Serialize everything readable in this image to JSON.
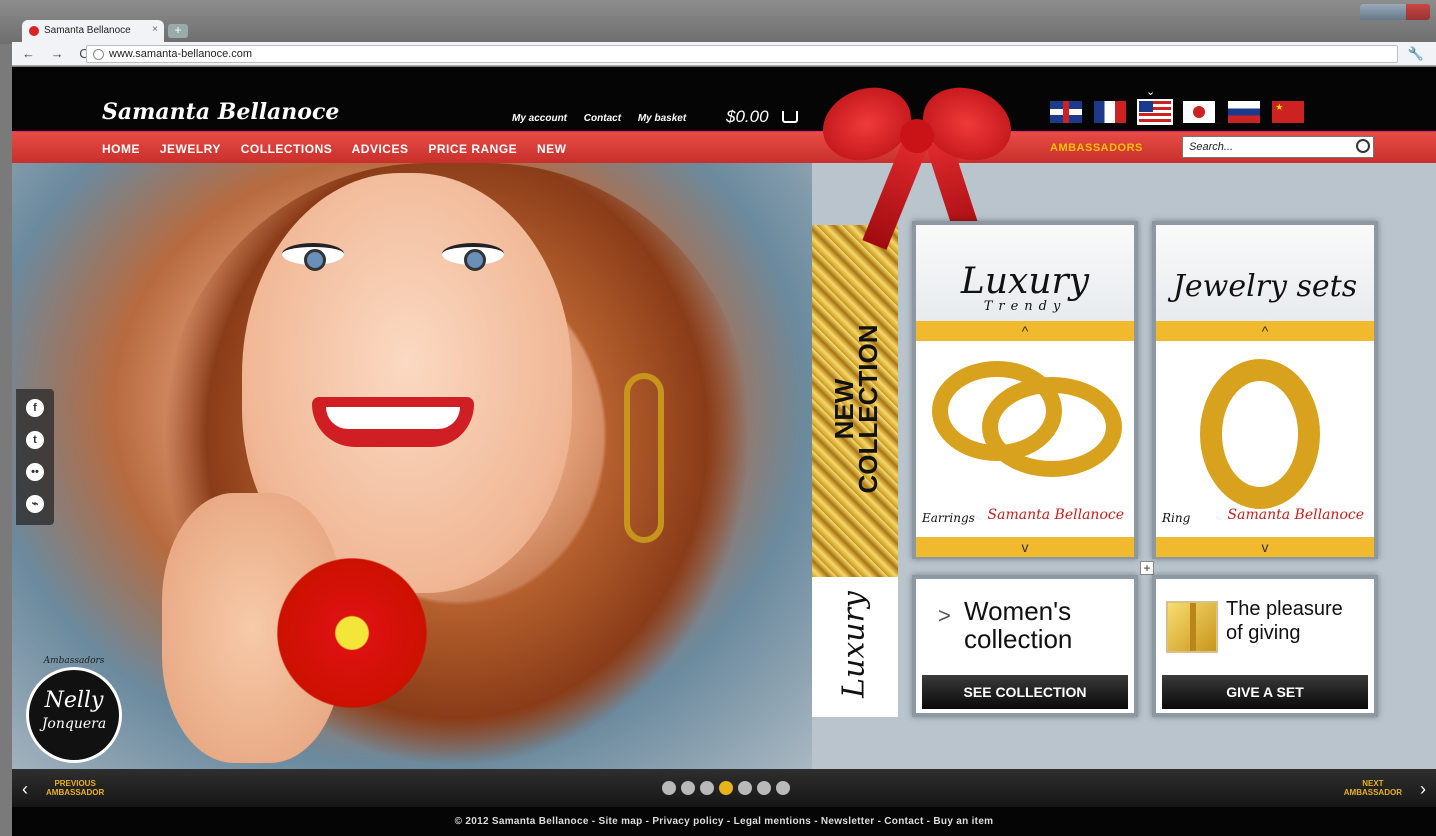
{
  "browser": {
    "tab_title": "Samanta Bellanoce",
    "tab_close": "×",
    "new_tab": "+",
    "url": "www.samanta-bellanoce.com",
    "nav_glyphs": "← → C",
    "wrench": "🔧"
  },
  "header": {
    "logo": "Samanta Bellanoce",
    "links": [
      "My account",
      "Contact",
      "My basket"
    ],
    "basket_total": "$0.00",
    "languages": [
      "English UK",
      "French",
      "English US",
      "Japanese",
      "Russian",
      "Chinese"
    ],
    "selected_language": "English US"
  },
  "nav": {
    "items": [
      "HOME",
      "JEWELRY",
      "COLLECTIONS",
      "ADVICES",
      "PRICE RANGE",
      "NEW"
    ],
    "ambassadors": "AMBASSADORS",
    "search_placeholder": "Search..."
  },
  "social": [
    "f",
    "t",
    "••",
    "⌁"
  ],
  "badge": {
    "top": "Ambassadors",
    "name1": "Nelly",
    "name2": "Jonquera"
  },
  "strip": {
    "new_collection_1": "NEW",
    "new_collection_2": "COLLECTION",
    "luxury": "Luxury"
  },
  "cards": [
    {
      "title": "Luxury",
      "subtitle": "Trendy",
      "product": "Earrings",
      "signature": "Samanta Bellanoce",
      "up": "^",
      "down": "v"
    },
    {
      "title": "Jewelry sets",
      "subtitle": "",
      "product": "Ring",
      "signature": "Samanta Bellanoce",
      "up": "^",
      "down": "v"
    }
  ],
  "plus": "+",
  "promos": [
    {
      "chevron": ">",
      "line1": "Women's",
      "line2": "collection",
      "button": "SEE COLLECTION"
    },
    {
      "line1": "The pleasure",
      "line2": "of giving",
      "button": "GIVE A SET"
    }
  ],
  "slider": {
    "prev_arrow": "‹",
    "prev_label_1": "PREVIOUS",
    "prev_label_2": "AMBASSADOR",
    "next_arrow": "›",
    "next_label_1": "NEXT",
    "next_label_2": "AMBASSADOR",
    "dots": 7,
    "active_dot": 4
  },
  "footer": "© 2012 Samanta Bellanoce - Site map - Privacy policy - Legal mentions - Newsletter - Contact - Buy an item"
}
